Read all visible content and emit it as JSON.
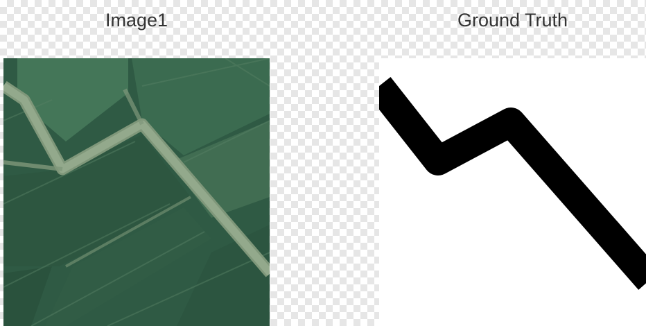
{
  "panels": {
    "left_title": "Image1",
    "right_title": "Ground Truth"
  },
  "colors": {
    "field_dark": "#2f5a44",
    "field_mid": "#3b6b50",
    "field_light": "#4a7d5e",
    "road": "#93a98c",
    "road_edge": "#7f977a",
    "mask_foreground": "#000000",
    "mask_background": "#ffffff"
  }
}
